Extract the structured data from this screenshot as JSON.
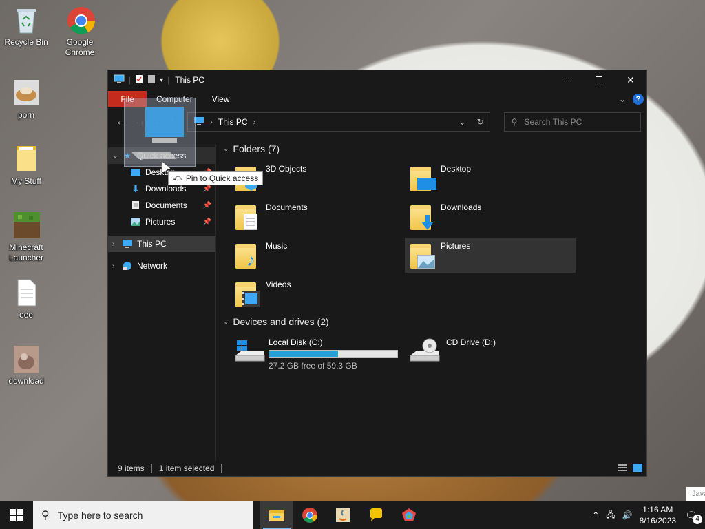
{
  "desktop": {
    "icons": [
      {
        "label": "Recycle Bin"
      },
      {
        "label": "Google Chrome"
      },
      {
        "label": "porn"
      },
      {
        "label": "My Stuff"
      },
      {
        "label": "Minecraft Launcher"
      },
      {
        "label": "eee"
      },
      {
        "label": "download"
      }
    ]
  },
  "window": {
    "title": "This PC",
    "ribbon_tabs": [
      "File",
      "Computer",
      "View"
    ],
    "help": "?",
    "address": {
      "crumb": "This PC",
      "sep": "›"
    },
    "search_placeholder": "Search This PC",
    "nav_pane": {
      "quick_access": "Quick access",
      "quick_items": [
        "Desktop",
        "Downloads",
        "Documents",
        "Pictures"
      ],
      "this_pc": "This PC",
      "network": "Network"
    },
    "groups": {
      "folders": "Folders (7)",
      "devices": "Devices and drives (2)"
    },
    "folders": [
      "3D Objects",
      "Desktop",
      "Documents",
      "Downloads",
      "Music",
      "Pictures",
      "Videos"
    ],
    "drives": [
      {
        "name": "Local Disk (C:)",
        "free": "27.2 GB free of 59.3 GB",
        "used_fraction": 0.54
      },
      {
        "name": "CD Drive (D:)"
      }
    ],
    "status": {
      "items": "9 items",
      "selected": "1 item selected"
    },
    "tooltip": "Pin to Quick access"
  },
  "taskbar": {
    "search_placeholder": "Type here to search",
    "time": "1:16 AM",
    "date": "8/16/2023",
    "notifications": "4",
    "peek_text": "Java"
  },
  "colors": {
    "accent_file_tab": "#c42b1c",
    "drive_bar_fill": "#26a0da",
    "window_bg": "#191919"
  }
}
